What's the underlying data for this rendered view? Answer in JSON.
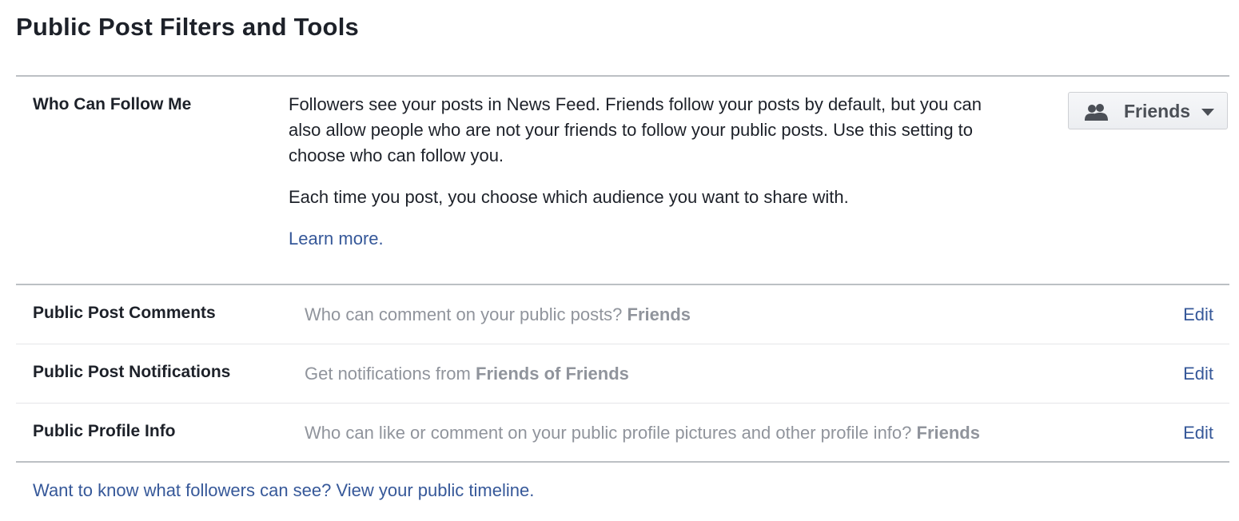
{
  "page": {
    "title": "Public Post Filters and Tools"
  },
  "follow": {
    "label": "Who Can Follow Me",
    "description_1": "Followers see your posts in News Feed. Friends follow your posts by default, but you can also allow people who are not your friends to follow your public posts. Use this setting to choose who can follow you.",
    "description_2": "Each time you post, you choose which audience you want to share with.",
    "learn_more": "Learn more.",
    "audience_selector": {
      "label": "Friends",
      "icon": "friends-icon",
      "caret_icon": "caret-down-icon"
    }
  },
  "settings": [
    {
      "label": "Public Post Comments",
      "question": "Who can comment on your public posts?",
      "value": "Friends",
      "edit": "Edit"
    },
    {
      "label": "Public Post Notifications",
      "question": "Get notifications from",
      "value": "Friends of Friends",
      "edit": "Edit"
    },
    {
      "label": "Public Profile Info",
      "question": "Who can like or comment on your public profile pictures and other profile info?",
      "value": "Friends",
      "edit": "Edit"
    }
  ],
  "footer": {
    "link": "Want to know what followers can see? View your public timeline."
  },
  "colors": {
    "link": "#365899",
    "text": "#1d2129",
    "muted": "#90949c",
    "divider": "#bcc0c4",
    "divider_light": "#e5e6e9"
  }
}
